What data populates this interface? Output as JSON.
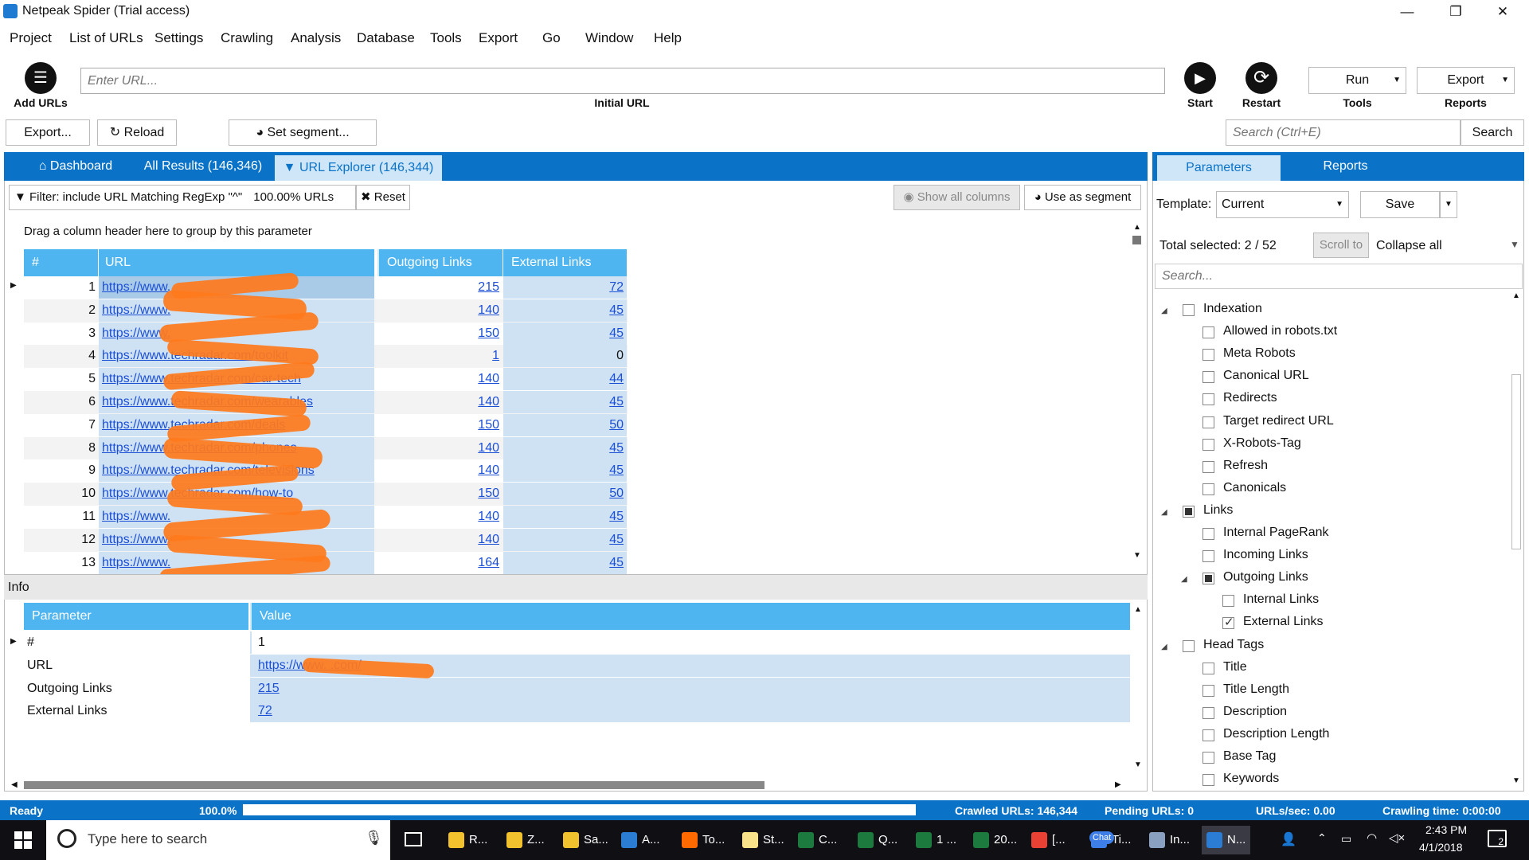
{
  "window": {
    "title": "Netpeak Spider (Trial access)"
  },
  "menu": [
    "Project",
    "List of URLs",
    "Settings",
    "Crawling",
    "Analysis",
    "Database",
    "Tools",
    "Export",
    "Go",
    "Window",
    "Help"
  ],
  "toolbar": {
    "add_urls": "Add URLs",
    "url_placeholder": "Enter URL...",
    "initial_url": "Initial URL",
    "start": "Start",
    "restart": "Restart",
    "run": "Run",
    "tools": "Tools",
    "export": "Export",
    "reports": "Reports"
  },
  "actionbar": {
    "export": "Export...",
    "reload": "Reload",
    "set_segment": "Set segment...",
    "search_placeholder": "Search (Ctrl+E)",
    "search": "Search"
  },
  "tabs": [
    {
      "label": "Dashboard"
    },
    {
      "label": "All Results (146,346)"
    },
    {
      "label": "URL Explorer (146,344)"
    }
  ],
  "filterbar": {
    "filter": "Filter: include URL Matching RegExp \"^\"",
    "percent": "100.00% URLs",
    "reset": "Reset",
    "show_all": "Show all columns",
    "use_segment": "Use as segment"
  },
  "results": {
    "group_hint": "Drag a column header here to group by this parameter",
    "columns": [
      "#",
      "URL",
      "Outgoing Links",
      "External Links"
    ],
    "rows": [
      {
        "n": "1",
        "url": "https://www.",
        "out": "215",
        "ext": "72"
      },
      {
        "n": "2",
        "url": "https://www.",
        "out": "140",
        "ext": "45"
      },
      {
        "n": "3",
        "url": "https://www.",
        "out": "150",
        "ext": "45"
      },
      {
        "n": "4",
        "url": "https://www.techradar.com/toolkit",
        "out": "1",
        "ext": "0"
      },
      {
        "n": "5",
        "url": "https://www.techradar.com/car-tech",
        "out": "140",
        "ext": "44"
      },
      {
        "n": "6",
        "url": "https://www.techradar.com/wearables",
        "out": "140",
        "ext": "45"
      },
      {
        "n": "7",
        "url": "https://www.techradar.com/deals",
        "out": "150",
        "ext": "50"
      },
      {
        "n": "8",
        "url": "https://www.techradar.com/phones",
        "out": "140",
        "ext": "45"
      },
      {
        "n": "9",
        "url": "https://www.techradar.com/televisions",
        "out": "140",
        "ext": "45"
      },
      {
        "n": "10",
        "url": "https://www.techradar.com/how-to",
        "out": "150",
        "ext": "50"
      },
      {
        "n": "11",
        "url": "https://www.",
        "out": "140",
        "ext": "45"
      },
      {
        "n": "12",
        "url": "https://www.",
        "out": "140",
        "ext": "45"
      },
      {
        "n": "13",
        "url": "https://www.",
        "out": "164",
        "ext": "45"
      }
    ]
  },
  "info": {
    "title": "Info",
    "columns": [
      "Parameter",
      "Value"
    ],
    "rows": [
      {
        "param": "#",
        "value": "1"
      },
      {
        "param": "URL",
        "value": "https://www.      .com/"
      },
      {
        "param": "Outgoing Links",
        "value": "215"
      },
      {
        "param": "External Links",
        "value": "72"
      }
    ]
  },
  "side": {
    "tabs": [
      "Parameters",
      "Reports"
    ],
    "template_label": "Template:",
    "template_value": "Current",
    "save": "Save",
    "total_selected": "Total selected: 2 / 52",
    "scroll_to": "Scroll to",
    "collapse_all": "Collapse all",
    "search_placeholder": "Search...",
    "tree": [
      {
        "label": "Indexation",
        "level": 0,
        "state": "unchecked",
        "expanded": true
      },
      {
        "label": "Allowed in robots.txt",
        "level": 1,
        "state": "unchecked"
      },
      {
        "label": "Meta Robots",
        "level": 1,
        "state": "unchecked"
      },
      {
        "label": "Canonical URL",
        "level": 1,
        "state": "unchecked"
      },
      {
        "label": "Redirects",
        "level": 1,
        "state": "unchecked"
      },
      {
        "label": "Target redirect URL",
        "level": 1,
        "state": "unchecked"
      },
      {
        "label": "X-Robots-Tag",
        "level": 1,
        "state": "unchecked"
      },
      {
        "label": "Refresh",
        "level": 1,
        "state": "unchecked"
      },
      {
        "label": "Canonicals",
        "level": 1,
        "state": "unchecked"
      },
      {
        "label": "Links",
        "level": 0,
        "state": "partial",
        "expanded": true
      },
      {
        "label": "Internal PageRank",
        "level": 1,
        "state": "unchecked"
      },
      {
        "label": "Incoming Links",
        "level": 1,
        "state": "unchecked"
      },
      {
        "label": "Outgoing Links",
        "level": 1,
        "state": "partial",
        "expanded": true
      },
      {
        "label": "Internal Links",
        "level": 2,
        "state": "unchecked"
      },
      {
        "label": "External Links",
        "level": 2,
        "state": "checked"
      },
      {
        "label": "Head Tags",
        "level": 0,
        "state": "unchecked",
        "expanded": true
      },
      {
        "label": "Title",
        "level": 1,
        "state": "unchecked"
      },
      {
        "label": "Title Length",
        "level": 1,
        "state": "unchecked"
      },
      {
        "label": "Description",
        "level": 1,
        "state": "unchecked"
      },
      {
        "label": "Description Length",
        "level": 1,
        "state": "unchecked"
      },
      {
        "label": "Base Tag",
        "level": 1,
        "state": "unchecked"
      },
      {
        "label": "Keywords",
        "level": 1,
        "state": "unchecked"
      }
    ]
  },
  "status": {
    "ready": "Ready",
    "percent": "100.0%",
    "progress": 1.0,
    "crawled": "Crawled URLs: 146,344",
    "pending": "Pending URLs: 0",
    "rate": "URLs/sec: 0.00",
    "time": "Crawling time: 0:00:00"
  },
  "taskbar": {
    "search_placeholder": "Type here to search",
    "apps": [
      "R...",
      "Z...",
      "Sa...",
      "A...",
      "To...",
      "St...",
      "C...",
      "Q...",
      "1 ...",
      "20...",
      "[...",
      "Ti...",
      "In...",
      "N..."
    ],
    "chat": "Chat",
    "time": "2:43 PM",
    "date": "4/1/2018",
    "notif_count": "2"
  },
  "colors": {
    "accent": "#0a73c8",
    "header": "#4fb5f0",
    "selection": "#cfe2f3",
    "redaction": "#ff7a1c"
  }
}
